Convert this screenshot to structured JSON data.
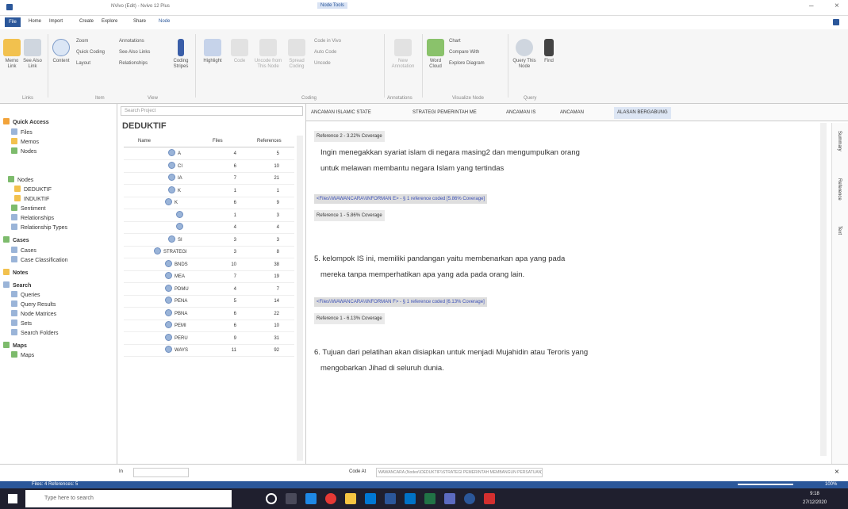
{
  "window": {
    "title": "NVivo (Edit) - Nvivo 12 Plus",
    "context_tab": "Node Tools"
  },
  "ribbon": {
    "tabs": [
      "File",
      "Home",
      "Import",
      "Create",
      "Explore",
      "Share",
      "Node"
    ],
    "buttons": [
      "Memo Link",
      "See Also Link",
      "Content",
      "Zoom",
      "Quick Coding",
      "Layout",
      "Annotations",
      "See Also Links",
      "Relationships",
      "Coding Stripes",
      "Highlight",
      "Code",
      "Uncode from This Node",
      "Spread Coding",
      "Code in Vivo",
      "Auto Code",
      "Uncode",
      "New Annotation",
      "Word Cloud",
      "Chart",
      "Compare With",
      "Explore Diagram",
      "Query This Node",
      "Find"
    ],
    "groups": [
      "Links",
      "Item",
      "View",
      "Coding",
      "Annotations",
      "Visualize Node",
      "Query"
    ]
  },
  "nav": {
    "search_placeholder": "Search Project",
    "items": [
      "Quick Access",
      "Files",
      "Memos",
      "Nodes",
      "Nodes",
      "DEDUKTIF",
      "INDUKTIF",
      "Sentiment",
      "Relationships",
      "Relationship Types",
      "Cases",
      "Cases",
      "Case Classification",
      "Notes",
      "Search",
      "Queries",
      "Query Results",
      "Node Matrices",
      "Sets",
      "Search Folders",
      "Maps",
      "Maps"
    ]
  },
  "list": {
    "title": "DEDUKTIF",
    "headers": [
      "Name",
      "Files",
      "References"
    ],
    "rows": [
      [
        "A",
        "4",
        "5"
      ],
      [
        "CI",
        "6",
        "10"
      ],
      [
        "IA",
        "7",
        "21"
      ],
      [
        "K",
        "1",
        "1"
      ],
      [
        "K",
        "6",
        "9"
      ],
      [
        "",
        "1",
        "3"
      ],
      [
        "",
        "4",
        "4"
      ],
      [
        "SI",
        "3",
        "3"
      ],
      [
        "STRATEGI",
        "3",
        "8"
      ],
      [
        "BNDS",
        "10",
        "38"
      ],
      [
        "MEA",
        "7",
        "19"
      ],
      [
        "PDMU",
        "4",
        "7"
      ],
      [
        "PENA",
        "5",
        "14"
      ],
      [
        "PBNA",
        "6",
        "22"
      ],
      [
        "PEMI",
        "6",
        "10"
      ],
      [
        "PERU",
        "9",
        "31"
      ],
      [
        "WAYS",
        "11",
        "92"
      ]
    ]
  },
  "doc": {
    "tabs": [
      "ANCAMAN ISLAMIC STATE",
      "STRATEGI PEMERINTAH ME",
      "ANCAMAN IS",
      "ANCAMAN",
      "ALASAN BERGABUNG"
    ],
    "ref1": "Reference 2 - 3.22% Coverage",
    "p1a": "Ingin menegakkan syariat islam di negara masing2 dan mengumpulkan orang",
    "p1b": "untuk melawan membantu negara Islam yang tertindas",
    "link1": "<Files\\\\WAWANCARA\\\\INFORMAN E> - § 1 reference coded [5.86% Coverage]",
    "ref2": "Reference 1 - 5.86% Coverage",
    "p2a": "5. kelompok IS ini, memiliki pandangan yaitu membenarkan apa yang pada",
    "p2b": "mereka tanpa memperhatikan apa yang ada pada orang lain.",
    "link2": "<Files\\\\WAWANCARA\\\\INFORMAN F> - § 1 reference coded [6.13% Coverage]",
    "ref3": "Reference 1 - 6.13% Coverage",
    "p3a": "6. Tujuan dari pelatihan akan disiapkan untuk menjadi Mujahidin atau Teroris yang",
    "p3b": "mengobarkan Jihad di seluruh dunia.",
    "side": [
      "Summary",
      "Reference",
      "Text"
    ]
  },
  "status": {
    "in": "In",
    "code_at": "Code At",
    "path": "WAWANCARA (Nodes\\\\DEDUKTIF\\\\STRATEGI PEMERINTAH MEMBANGUN PERSATUAN)",
    "counts": "Files: 4  References: 5",
    "zoom": "100%"
  },
  "taskbar": {
    "search": "Type here to search",
    "time": "9:18",
    "date": "27/12/2020"
  }
}
